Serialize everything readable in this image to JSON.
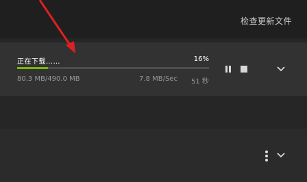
{
  "header": {
    "check_updates_label": "检查更新文件"
  },
  "download": {
    "status_text": "正在下载……",
    "percent_text": "16%",
    "progress_fraction": 0.16,
    "downloaded_text": "80.3 MB/490.0 MB",
    "speed_text": "7.8 MB/Sec",
    "remaining_text": "51 秒"
  },
  "colors": {
    "progress_fill": "#76b900",
    "arrow": "#e02020",
    "background": "#262626",
    "card": "#323232"
  },
  "icons": {
    "pause": "pause-icon",
    "stop": "stop-icon",
    "expand": "chevron-down-icon",
    "more": "kebab-menu-icon"
  }
}
